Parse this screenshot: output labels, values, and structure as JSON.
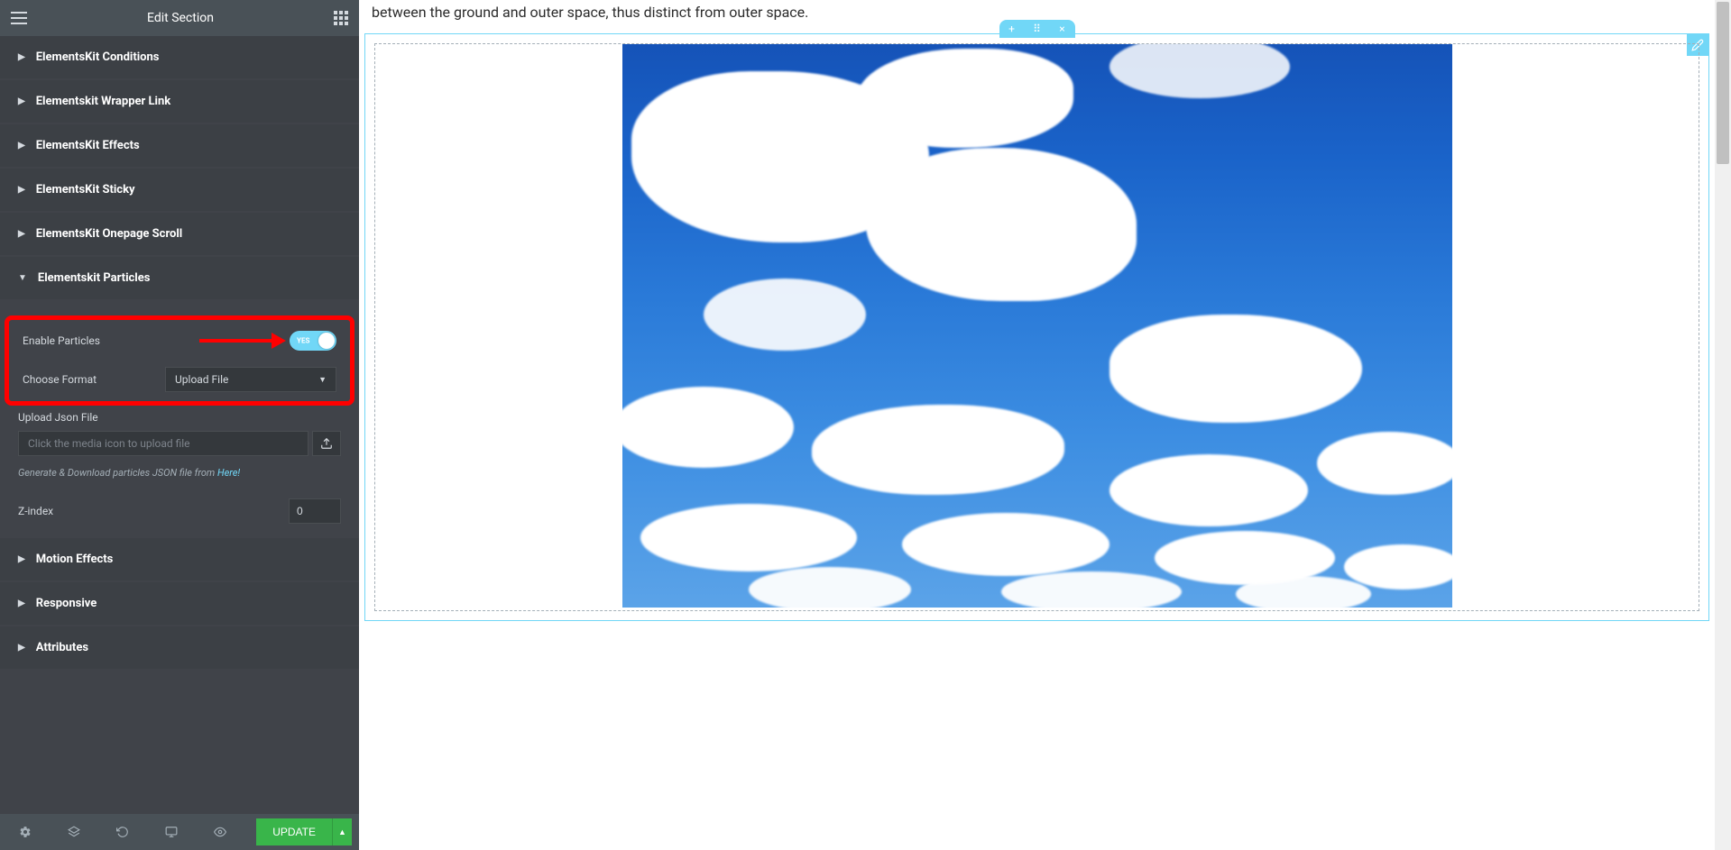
{
  "sidebar": {
    "title": "Edit Section",
    "sections": {
      "conditions": "ElementsKit Conditions",
      "wrapper_link": "Elementskit Wrapper Link",
      "effects": "ElementsKit Effects",
      "sticky": "ElementsKit Sticky",
      "onepage_scroll": "ElementsKit Onepage Scroll",
      "particles": "Elementskit Particles",
      "motion_effects": "Motion Effects",
      "responsive": "Responsive",
      "attributes": "Attributes"
    },
    "particles": {
      "enable_label": "Enable Particles",
      "toggle_state": "YES",
      "choose_format_label": "Choose Format",
      "format_selected": "Upload File",
      "upload_json_label": "Upload Json File",
      "upload_placeholder": "Click the media icon to upload file",
      "hint_prefix": "Generate & Download particles JSON file from ",
      "hint_link": "Here!",
      "zindex_label": "Z-index",
      "zindex_value": "0"
    },
    "footer": {
      "update_label": "UPDATE"
    }
  },
  "main": {
    "top_text": "between the ground and outer space, thus distinct from outer space."
  }
}
